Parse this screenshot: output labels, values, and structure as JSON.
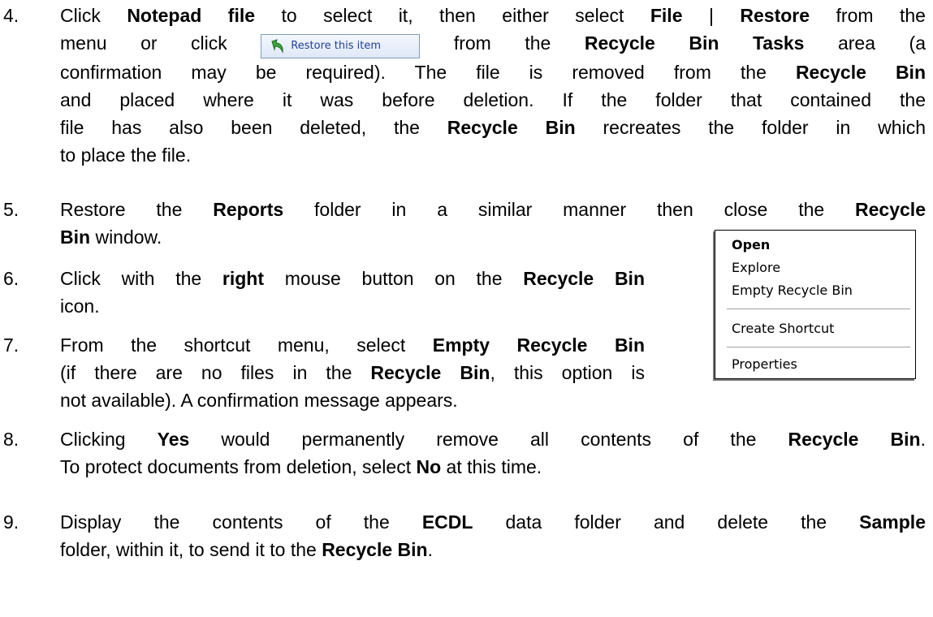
{
  "steps": [
    {
      "number": "4.",
      "lines": [
        {
          "segments": [
            {
              "text": "Click ",
              "bold": false
            },
            {
              "text": "Notepad file",
              "bold": true
            },
            {
              "text": " to select it, then either select ",
              "bold": false
            },
            {
              "text": "File",
              "bold": true
            },
            {
              "text": " | ",
              "bold": false
            },
            {
              "text": "Restore",
              "bold": true
            },
            {
              "text": " from the",
              "bold": false
            }
          ]
        },
        {
          "segments": [
            {
              "text": "menu or click ",
              "bold": false
            },
            {
              "button": "restore"
            },
            {
              "text": " from the ",
              "bold": false
            },
            {
              "text": "Recycle Bin Tasks",
              "bold": true
            },
            {
              "text": " area (a",
              "bold": false
            }
          ]
        },
        {
          "segments": [
            {
              "text": "confirmation may be required). The file is removed from the ",
              "bold": false
            },
            {
              "text": "Recycle Bin",
              "bold": true
            }
          ]
        },
        {
          "segments": [
            {
              "text": "and placed where it was before deletion. If the folder that contained the",
              "bold": false
            }
          ]
        },
        {
          "segments": [
            {
              "text": "file has also been deleted, the ",
              "bold": false
            },
            {
              "text": "Recycle Bin",
              "bold": true
            },
            {
              "text": " recreates the folder in which",
              "bold": false
            }
          ]
        },
        {
          "segments": [
            {
              "text": "to place the file.",
              "bold": false
            }
          ],
          "last": true
        }
      ]
    },
    {
      "number": "5.",
      "lines": [
        {
          "segments": [
            {
              "text": "Restore the ",
              "bold": false
            },
            {
              "text": "Reports",
              "bold": true
            },
            {
              "text": " folder in a similar manner then close the ",
              "bold": false
            },
            {
              "text": "Recycle",
              "bold": true
            }
          ]
        },
        {
          "segments": [
            {
              "text": "Bin",
              "bold": true
            },
            {
              "text": " window.",
              "bold": false
            }
          ],
          "last": true
        }
      ]
    },
    {
      "number": "6.",
      "lines": [
        {
          "segments": [
            {
              "text": "Click with the ",
              "bold": false
            },
            {
              "text": "right",
              "bold": true
            },
            {
              "text": " mouse button on the ",
              "bold": false
            },
            {
              "text": "Recycle Bin",
              "bold": true
            }
          ]
        },
        {
          "segments": [
            {
              "text": "icon.",
              "bold": false
            }
          ],
          "last": true
        }
      ]
    },
    {
      "number": "7.",
      "lines": [
        {
          "segments": [
            {
              "text": "From the shortcut menu, select ",
              "bold": false
            },
            {
              "text": "Empty Recycle Bin",
              "bold": true
            }
          ]
        },
        {
          "segments": [
            {
              "text": "(if there are no files in the ",
              "bold": false
            },
            {
              "text": "Recycle Bin",
              "bold": true
            },
            {
              "text": ", this option is",
              "bold": false
            }
          ]
        },
        {
          "segments": [
            {
              "text": "not available). A confirmation message appears.",
              "bold": false
            }
          ],
          "last": true
        }
      ]
    },
    {
      "number": "8.",
      "lines": [
        {
          "segments": [
            {
              "text": "Clicking ",
              "bold": false
            },
            {
              "text": "Yes",
              "bold": true
            },
            {
              "text": " would permanently remove all contents of the ",
              "bold": false
            },
            {
              "text": "Recycle Bin",
              "bold": true
            },
            {
              "text": ".",
              "bold": false
            }
          ]
        },
        {
          "segments": [
            {
              "text": "To protect documents from deletion, select ",
              "bold": false
            },
            {
              "text": "No",
              "bold": true
            },
            {
              "text": " at this time.",
              "bold": false
            }
          ],
          "last": true
        }
      ]
    },
    {
      "number": "9.",
      "lines": [
        {
          "segments": [
            {
              "text": "Display the contents of the ",
              "bold": false
            },
            {
              "text": "ECDL",
              "bold": true
            },
            {
              "text": " data folder and delete the ",
              "bold": false
            },
            {
              "text": "Sample",
              "bold": true
            }
          ]
        },
        {
          "segments": [
            {
              "text": "folder, within it, to send it to the ",
              "bold": false
            },
            {
              "text": "Recycle Bin",
              "bold": true
            },
            {
              "text": ".",
              "bold": false
            }
          ],
          "last": true
        }
      ]
    }
  ],
  "restore_button": {
    "label": "Restore this item",
    "icon": "green-arrow-restore-icon"
  },
  "context_menu": {
    "items": [
      {
        "label": "Open",
        "bold": true
      },
      {
        "label": "Explore",
        "bold": false
      },
      {
        "label": "Empty Recycle Bin",
        "bold": false
      },
      {
        "separator": true
      },
      {
        "label": "Create Shortcut",
        "bold": false
      },
      {
        "separator": true
      },
      {
        "label": "Properties",
        "bold": false
      }
    ]
  }
}
